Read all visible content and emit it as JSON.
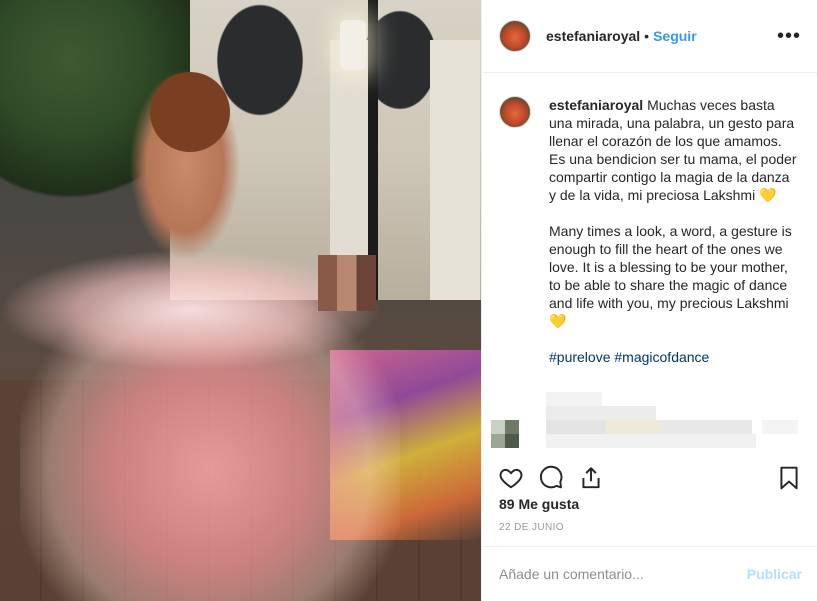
{
  "post": {
    "username": "estefaniaroyal",
    "follow_label": "Seguir",
    "separator": "•",
    "more_icon": "more-horizontal-icon",
    "caption_paragraphs": [
      "Muchas veces basta una mirada, una palabra, un gesto para llenar el corazón de los que amamos. Es una bendicion ser tu mama, el poder compartir contigo la magia de la danza y de la vida, mi preciosa Lakshmi",
      "Many times a look, a word, a gesture is enough to fill the heart of the ones we love. It is a blessing to be your mother, to be able to share the magic of dance and life with you, my precious Lakshmi"
    ],
    "heart_emoji": "💛",
    "hashtags": [
      "#purelove",
      "#magicofdance"
    ],
    "likes_text": "89 Me gusta",
    "date_text": "22 DE JUNIO",
    "comment_placeholder": "Añade un comentario...",
    "publish_label": "Publicar"
  },
  "colors": {
    "link_blue": "#3897f0",
    "hashtag_blue": "#003569",
    "publish_disabled": "#b2dffc",
    "muted_text": "#999999",
    "border": "#efefef"
  }
}
